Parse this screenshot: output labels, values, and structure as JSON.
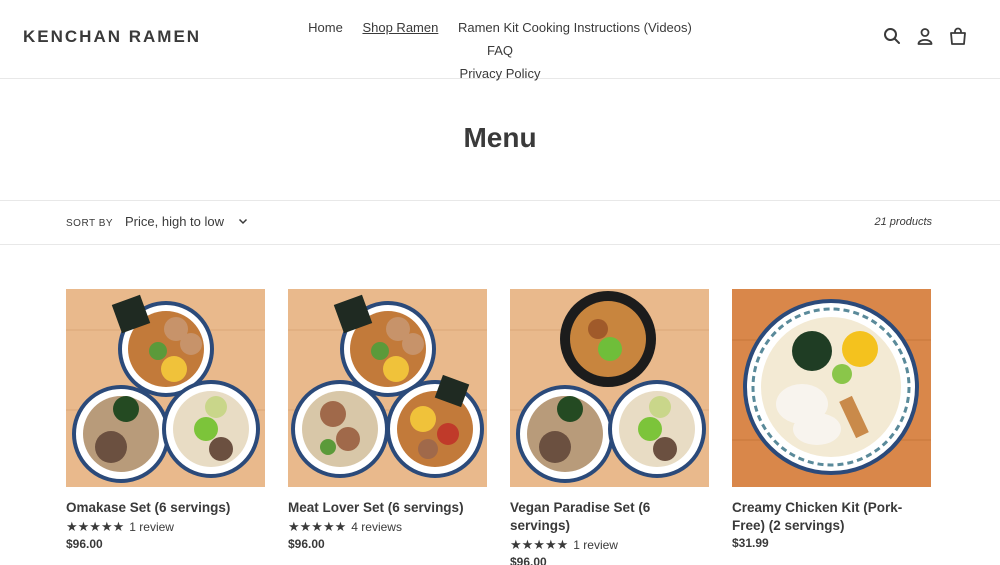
{
  "header": {
    "logo": "KENCHAN RAMEN",
    "nav": [
      {
        "label": "Home",
        "active": false
      },
      {
        "label": "Shop Ramen",
        "active": true
      },
      {
        "label": "Ramen Kit Cooking Instructions (Videos)",
        "active": false
      },
      {
        "label": "FAQ",
        "active": false
      },
      {
        "label": "Privacy Policy",
        "active": false
      }
    ],
    "icons": [
      "search-icon",
      "account-icon",
      "cart-icon"
    ]
  },
  "page": {
    "title": "Menu"
  },
  "filter": {
    "sort_label": "SORT BY",
    "sort_value": "Price, high to low",
    "count": "21 products"
  },
  "products": [
    {
      "name": "Omakase Set (6 servings)",
      "stars": "★★★★★",
      "reviews": "1 review",
      "price": "$96.00"
    },
    {
      "name": "Meat Lover Set (6 servings)",
      "stars": "★★★★★",
      "reviews": "4 reviews",
      "price": "$96.00"
    },
    {
      "name": "Vegan Paradise Set (6 servings)",
      "stars": "★★★★★",
      "reviews": "1 review",
      "price": "$96.00"
    },
    {
      "name": "Creamy Chicken Kit (Pork-Free) (2 servings)",
      "stars": "",
      "reviews": "",
      "price": "$31.99"
    }
  ],
  "colors": {
    "text": "#3a3a3a",
    "border": "#e8e8e8",
    "wood": "#e9b98c"
  }
}
